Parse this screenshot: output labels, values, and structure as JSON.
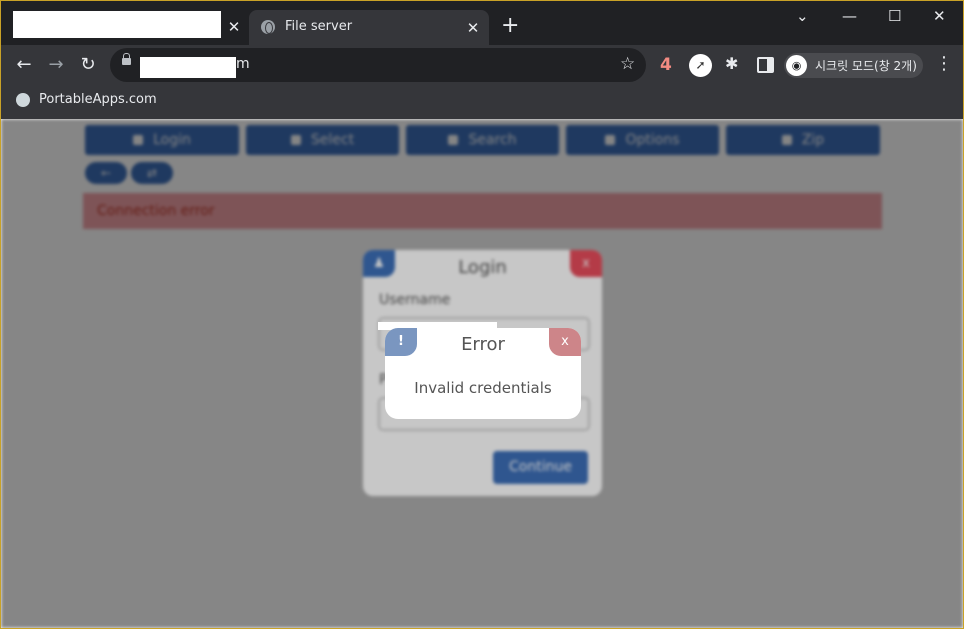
{
  "browser": {
    "active_tab_title": "File server",
    "tab_close": "✕",
    "new_tab": "+",
    "url_suffix": "m",
    "extension_count": "4",
    "incognito_label": "시크릿 모드(창 2개)",
    "bookmark": "PortableApps.com"
  },
  "toolbar": {
    "buttons": [
      "Login",
      "Select",
      "Search",
      "Options",
      "Zip"
    ],
    "small": [
      "←",
      "⇄"
    ]
  },
  "error_bar": "Connection error",
  "login": {
    "title": "Login",
    "close": "x",
    "username_label": "Username",
    "password_label": "P",
    "continue": "Continue"
  },
  "error_popup": {
    "badge": "!",
    "title": "Error",
    "close": "x",
    "message": "Invalid credentials"
  },
  "colors": {
    "primary": "#3d6fb8",
    "danger": "#e74c5b",
    "error_bg": "#f2a1a8"
  }
}
